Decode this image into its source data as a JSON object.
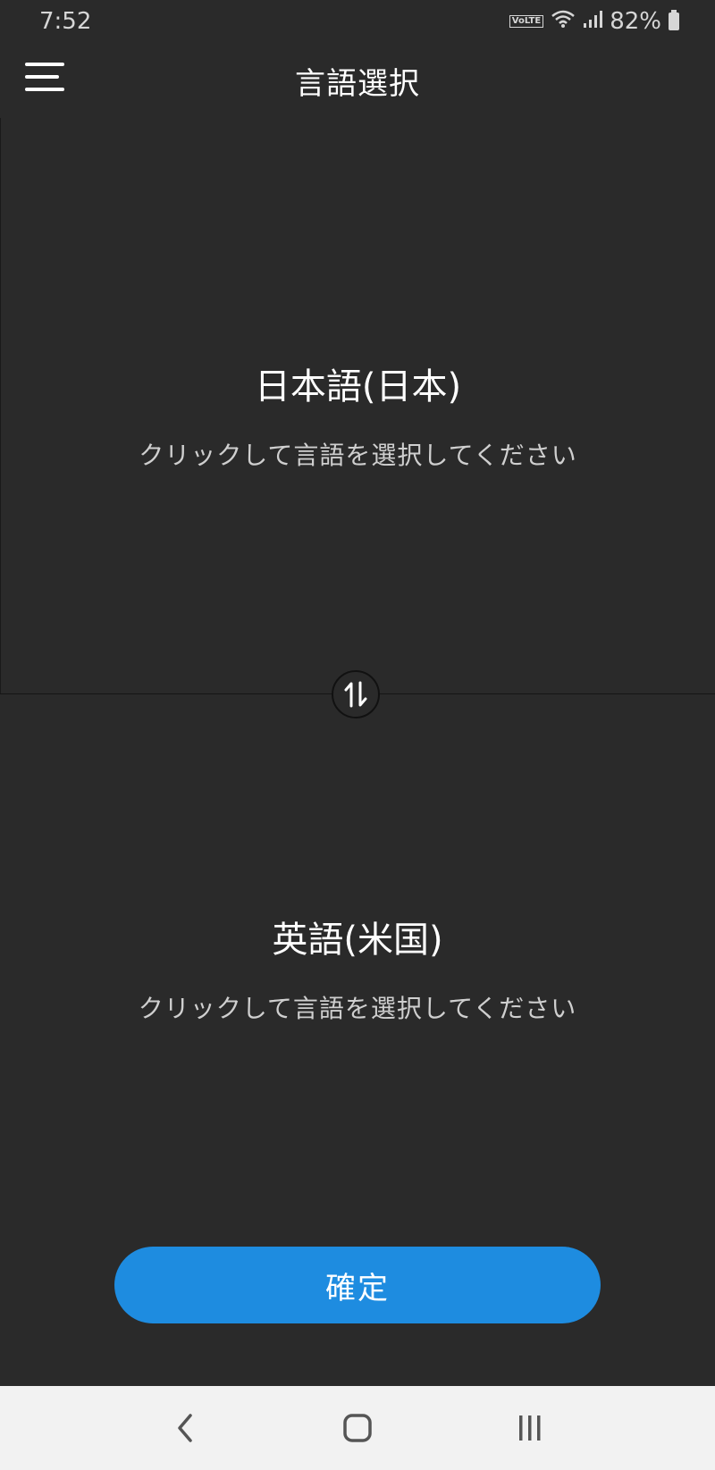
{
  "status_bar": {
    "time": "7:52",
    "network_label": "VoLTE",
    "battery_percent": "82%",
    "battery_level": 0.82,
    "icons": [
      "wifi-icon",
      "signal-icon",
      "battery-icon"
    ]
  },
  "app_bar": {
    "title": "言語選択",
    "menu_icon": "menu-icon"
  },
  "source_language": {
    "name": "日本語(日本)",
    "hint": "クリックして言語を選択してください"
  },
  "target_language": {
    "name": "英語(米国)",
    "hint": "クリックして言語を選択してください"
  },
  "swap": {
    "icon": "swap-vertical-icon"
  },
  "confirm": {
    "label": "確定"
  },
  "nav_bar": {
    "icons": [
      "back-icon",
      "home-icon",
      "recent-apps-icon"
    ]
  },
  "colors": {
    "background": "#2a2a2a",
    "accent": "#1e8ce0",
    "nav_background": "#f2f2f2"
  }
}
